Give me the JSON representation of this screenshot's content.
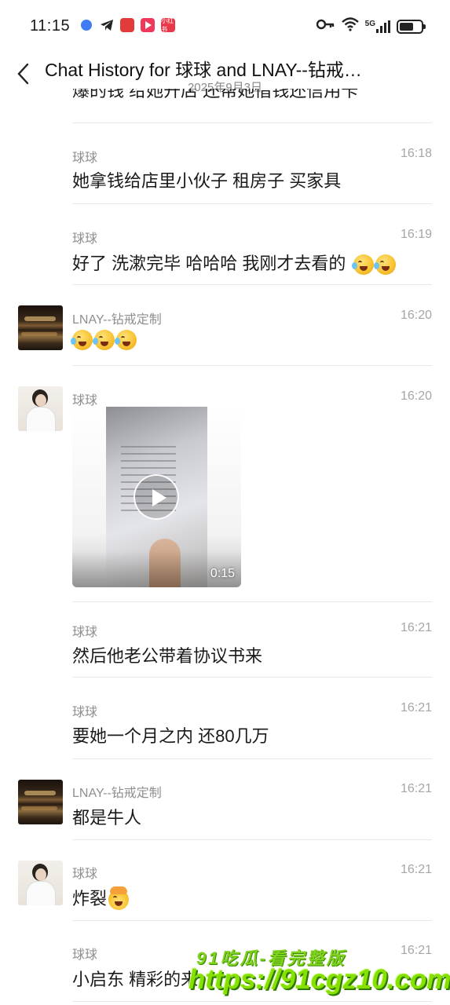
{
  "status_bar": {
    "time": "11:15",
    "left_icons": [
      "browser-dot-icon",
      "telegram-icon",
      "app-red-icon",
      "video-app-icon",
      "xiaohongshu-icon"
    ],
    "xiaohongshu_label": "小红书",
    "network": "5G",
    "right_icons": [
      "key-icon",
      "wifi-icon",
      "signal-icon",
      "battery-icon"
    ],
    "battery_level": 0.65
  },
  "header": {
    "title": "Chat History for 球球 and LNAY--钻戒…",
    "date": "2025年9月3日",
    "back_icon": "chevron-left-icon"
  },
  "partial_text": "爆的钱 给她开店 还帮她借钱还信用卡",
  "messages": [
    {
      "sender": "球球",
      "time": "16:18",
      "text": "她拿钱给店里小伙子 租房子 买家具"
    },
    {
      "sender": "球球",
      "time": "16:19",
      "text": "好了 洗漱完毕 哈哈哈 我刚才去看的",
      "emoji": [
        "laugh-cry-icon",
        "laugh-cry-icon"
      ]
    },
    {
      "sender": "LNAY--钻戒定制",
      "time": "16:20",
      "emoji": [
        "laugh-cry-icon",
        "laugh-cry-icon",
        "laugh-cry-icon"
      ]
    },
    {
      "sender": "球球",
      "time": "16:20",
      "video_duration": "0:15"
    },
    {
      "sender": "球球",
      "time": "16:21",
      "text": "然后他老公带着协议书来"
    },
    {
      "sender": "球球",
      "time": "16:21",
      "text": "要她一个月之内 还80几万"
    },
    {
      "sender": "LNAY--钻戒定制",
      "time": "16:21",
      "text": "都是牛人"
    },
    {
      "sender": "球球",
      "time": "16:21",
      "text": "炸裂",
      "emoji": [
        "exploding-head-icon"
      ]
    },
    {
      "sender": "球球",
      "time": "16:21",
      "text": "小启东 精彩的来"
    }
  ],
  "watermark": {
    "line1": "91吃瓜-看完整版",
    "line2": "https://91cgz10.com"
  }
}
